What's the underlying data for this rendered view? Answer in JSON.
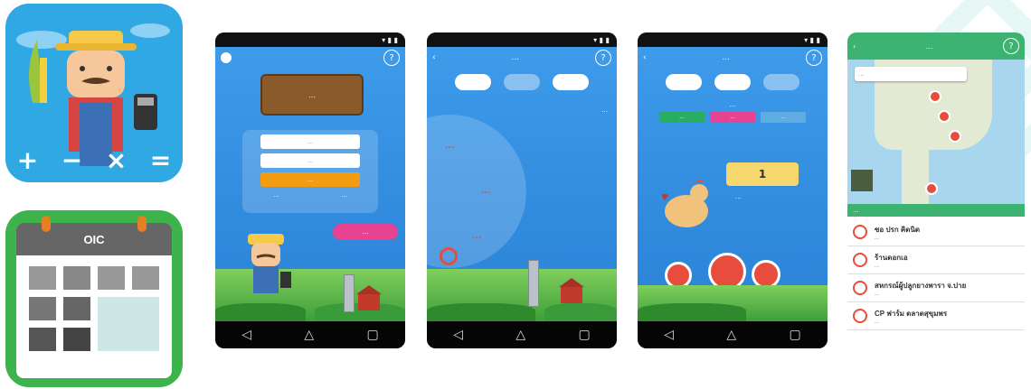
{
  "farmer_icon": {
    "symbols": [
      "+",
      "−",
      "×",
      "="
    ]
  },
  "calendar_icon": {
    "title": "OIC"
  },
  "phone_login": {
    "sign_text": "...",
    "username_placeholder": "...",
    "password_placeholder": "...",
    "login_button": "...",
    "link_left": "...",
    "link_right": "...",
    "pink_button": "..."
  },
  "phone_menu": {
    "title": "...",
    "question": "...",
    "segments": [
      "...",
      "...",
      "..."
    ]
  },
  "phone_detail": {
    "title": "...",
    "subtitle": "...",
    "tab_labels": [
      "...",
      "...",
      "..."
    ],
    "counter_value": "1",
    "field_label": "..."
  },
  "phone_map": {
    "title": "...",
    "search_placeholder": "...",
    "section_label": "...",
    "list": [
      {
        "title": "ซอ ปรก คิดนิด",
        "sub": "..."
      },
      {
        "title": "ร้านดอกเอ",
        "sub": "..."
      },
      {
        "title": "สหกรณ์ผู้ปลูกยางพารา จ.ปาย",
        "sub": "..."
      },
      {
        "title": "CP ฟาร์ม ตลาดสุขุมพร",
        "sub": "..."
      }
    ]
  },
  "nav": {
    "back": "◁",
    "home": "△",
    "recent": "▢"
  },
  "colors": {
    "accent_blue": "#2a82d6",
    "app_green": "#3cb44b",
    "pin_red": "#e74c3c",
    "orange": "#f39c12"
  }
}
